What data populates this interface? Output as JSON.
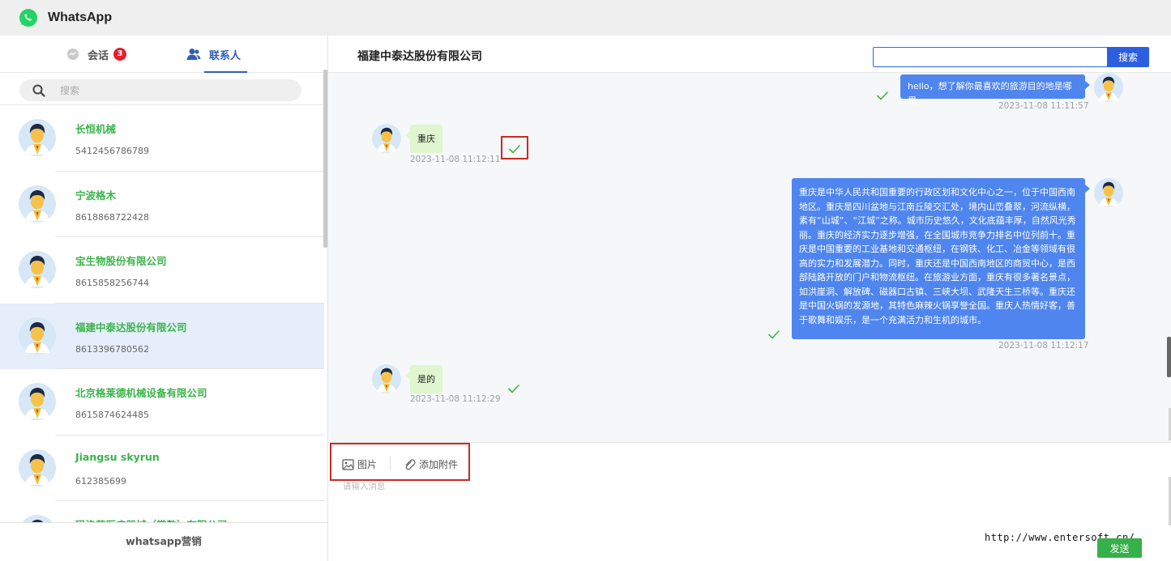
{
  "app": {
    "title": "WhatsApp",
    "logo_icon": "whatsapp-logo-icon",
    "brand_color": "#25D366"
  },
  "sidebar": {
    "tabs": [
      {
        "label": "会话",
        "icon": "chat-bubble-icon",
        "badge": "3"
      },
      {
        "label": "联系人",
        "icon": "contacts-icon",
        "active": true
      }
    ],
    "search": {
      "placeholder": "搜索"
    },
    "contacts": [
      {
        "name": "长恒机械",
        "phone": "5412456786789"
      },
      {
        "name": "宁波格木",
        "phone": "8618868722428"
      },
      {
        "name": "宝生物股份有限公司",
        "phone": "8615858256744"
      },
      {
        "name": "福建中泰达股份有限公司",
        "phone": "8613396780562",
        "active": true
      },
      {
        "name": "北京格莱德机械设备有限公司",
        "phone": "8615874624485"
      },
      {
        "name": "Jiangsu skyrun",
        "phone": "612385699"
      },
      {
        "name": "玛洛芬医疗器械（常熟）有限公司",
        "phone": ""
      }
    ],
    "footer_label": "whatsapp营销"
  },
  "chat": {
    "title": "福建中泰达股份有限公司",
    "search_button": "搜索",
    "messages": [
      {
        "direction": "out",
        "text": "hello，想了解你最喜欢的旅游目的地是哪里",
        "time": "2023-11-08 11:11:57"
      },
      {
        "direction": "in",
        "text": "重庆",
        "time": "2023-11-08 11:12:11"
      },
      {
        "direction": "out",
        "text": "重庆是中华人民共和国重要的行政区划和文化中心之一，位于中国西南地区。重庆是四川盆地与江南丘陵交汇处，境内山峦叠翠，河流纵横，素有“山城”、“江城”之称。城市历史悠久，文化底蕴丰厚，自然风光秀丽。重庆的经济实力逐步增强，在全国城市竞争力排名中位列前十。重庆是中国重要的工业基地和交通枢纽，在钢铁、化工、冶金等领域有很高的实力和发展潜力。同时，重庆还是中国西南地区的商贸中心，是西部陆路开放的门户和物流枢纽。在旅游业方面，重庆有很多著名景点，如洪崖洞、解放碑、磁器口古镇、三峡大坝、武隆天生三桥等。重庆还是中国火锅的发源地，其特色麻辣火锅享誉全国。重庆人热情好客，善于歌舞和娱乐，是一个充满活力和生机的城市。",
        "time": "2023-11-08 11:12:17"
      },
      {
        "direction": "in",
        "text": "是的",
        "time": "2023-11-08 11:12:29"
      }
    ]
  },
  "composer": {
    "image_label": "图片",
    "attach_label": "添加附件",
    "placeholder": "请输入消息",
    "send_label": "发送",
    "watermark": "http://www.entersoft.cn/"
  }
}
